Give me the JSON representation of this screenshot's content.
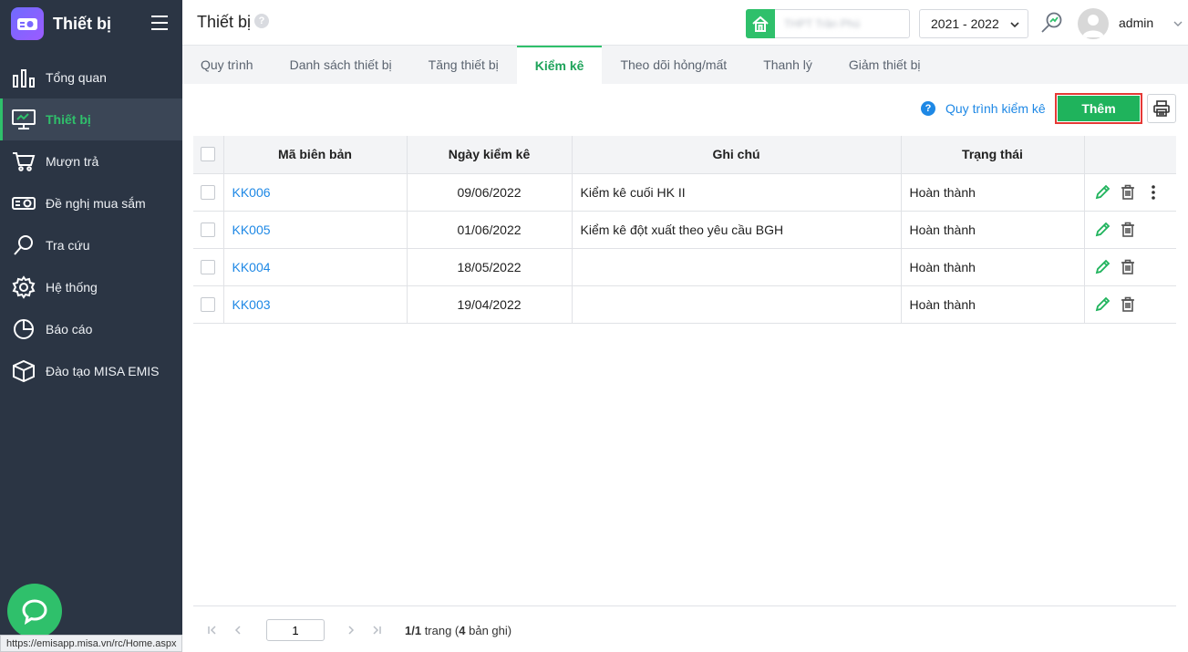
{
  "app": {
    "title": "Thiết bị"
  },
  "sidebar": {
    "items": [
      {
        "label": "Tổng quan",
        "icon": "chart-bars-icon",
        "active": false
      },
      {
        "label": "Thiết bị",
        "icon": "monitor-icon",
        "active": true
      },
      {
        "label": "Mượn trả",
        "icon": "cart-icon",
        "active": false
      },
      {
        "label": "Đề nghị mua sắm",
        "icon": "projector-icon",
        "active": false
      },
      {
        "label": "Tra cứu",
        "icon": "search-icon",
        "active": false
      },
      {
        "label": "Hệ thống",
        "icon": "gear-icon",
        "active": false
      },
      {
        "label": "Báo cáo",
        "icon": "pie-chart-icon",
        "active": false
      },
      {
        "label": "Đào tạo MISA EMIS",
        "icon": "cube-icon",
        "active": false
      }
    ]
  },
  "header": {
    "title": "Thiết bị",
    "help": "?",
    "school": "THPT Trần Phú",
    "year": "2021 - 2022",
    "user": "admin"
  },
  "tabs": [
    {
      "label": "Quy trình",
      "active": false
    },
    {
      "label": "Danh sách thiết bị",
      "active": false
    },
    {
      "label": "Tăng thiết bị",
      "active": false
    },
    {
      "label": "Kiểm kê",
      "active": true
    },
    {
      "label": "Theo dõi hỏng/mất",
      "active": false
    },
    {
      "label": "Thanh lý",
      "active": false
    },
    {
      "label": "Giảm thiết bị",
      "active": false
    }
  ],
  "toolbar": {
    "guide_label": "Quy trình kiểm kê",
    "add_label": "Thêm"
  },
  "table": {
    "headers": {
      "code": "Mã biên bản",
      "date": "Ngày kiểm kê",
      "note": "Ghi chú",
      "status": "Trạng thái"
    },
    "rows": [
      {
        "code": "KK006",
        "date": "09/06/2022",
        "note": "Kiểm kê cuối HK II",
        "status": "Hoàn thành"
      },
      {
        "code": "KK005",
        "date": "01/06/2022",
        "note": "Kiểm kê đột xuất theo yêu cầu BGH",
        "status": "Hoàn thành"
      },
      {
        "code": "KK004",
        "date": "18/05/2022",
        "note": "",
        "status": "Hoàn thành"
      },
      {
        "code": "KK003",
        "date": "19/04/2022",
        "note": "",
        "status": "Hoàn thành"
      }
    ]
  },
  "pager": {
    "page": "1",
    "pages_text": "1/1",
    "trang": " trang (",
    "count": "4",
    "records_text": " bản ghi)"
  },
  "status_bar": {
    "url": "https://emisapp.misa.vn/rc/Home.aspx"
  },
  "colors": {
    "sidebar_bg": "#2b3544",
    "accent_green": "#2fc06b",
    "link_blue": "#1e88e5",
    "highlight_red": "#e53935"
  }
}
